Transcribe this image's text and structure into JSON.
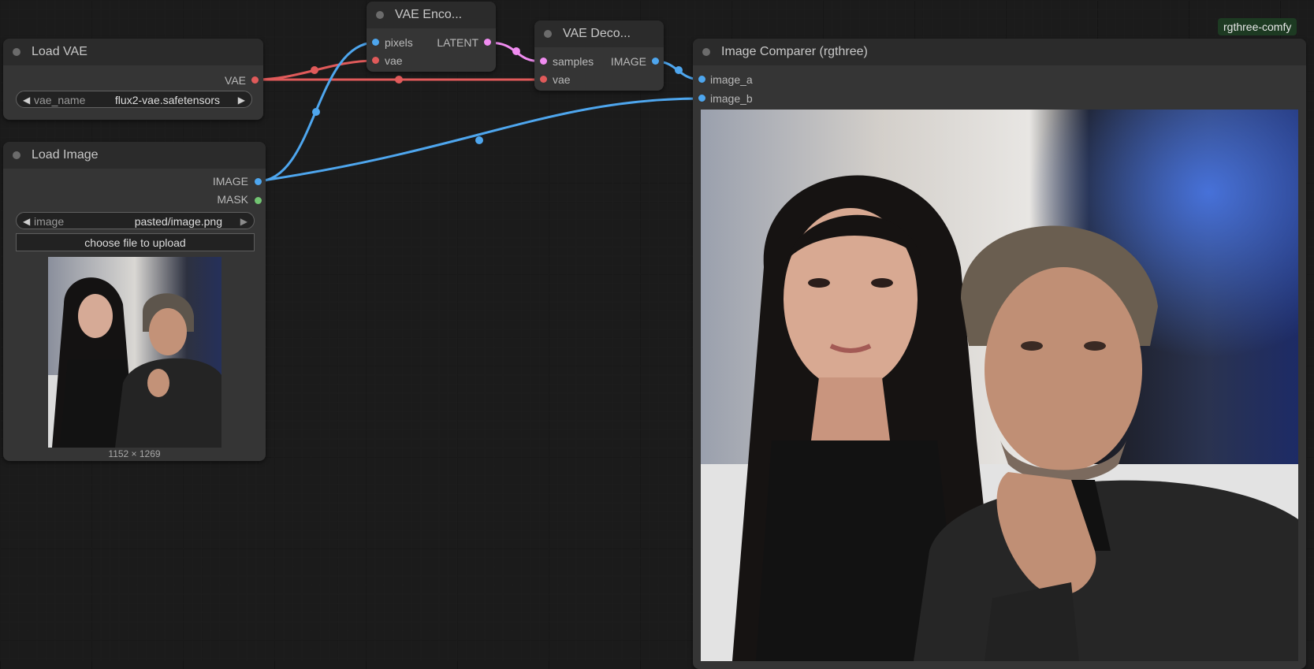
{
  "badge": "rgthree-comfy",
  "colors": {
    "vae_link": "#e05a5a",
    "image_link": "#4ea6ee",
    "latent_link": "#f08cf0",
    "mask_slot": "#72c472"
  },
  "nodes": {
    "load_vae": {
      "title": "Load VAE",
      "output_vae": "VAE",
      "widget_label": "vae_name",
      "widget_value": "flux2-vae.safetensors"
    },
    "load_image": {
      "title": "Load Image",
      "output_image": "IMAGE",
      "output_mask": "MASK",
      "widget_label": "image",
      "widget_value": "pasted/image.png",
      "upload_label": "choose file to upload",
      "preview_size": "1152 × 1269"
    },
    "vae_encode": {
      "title": "VAE Enco...",
      "input_pixels": "pixels",
      "input_vae": "vae",
      "output_latent": "LATENT"
    },
    "vae_decode": {
      "title": "VAE Deco...",
      "input_samples": "samples",
      "input_vae": "vae",
      "output_image": "IMAGE"
    },
    "image_comparer": {
      "title": "Image Comparer (rgthree)",
      "input_a": "image_a",
      "input_b": "image_b"
    }
  }
}
